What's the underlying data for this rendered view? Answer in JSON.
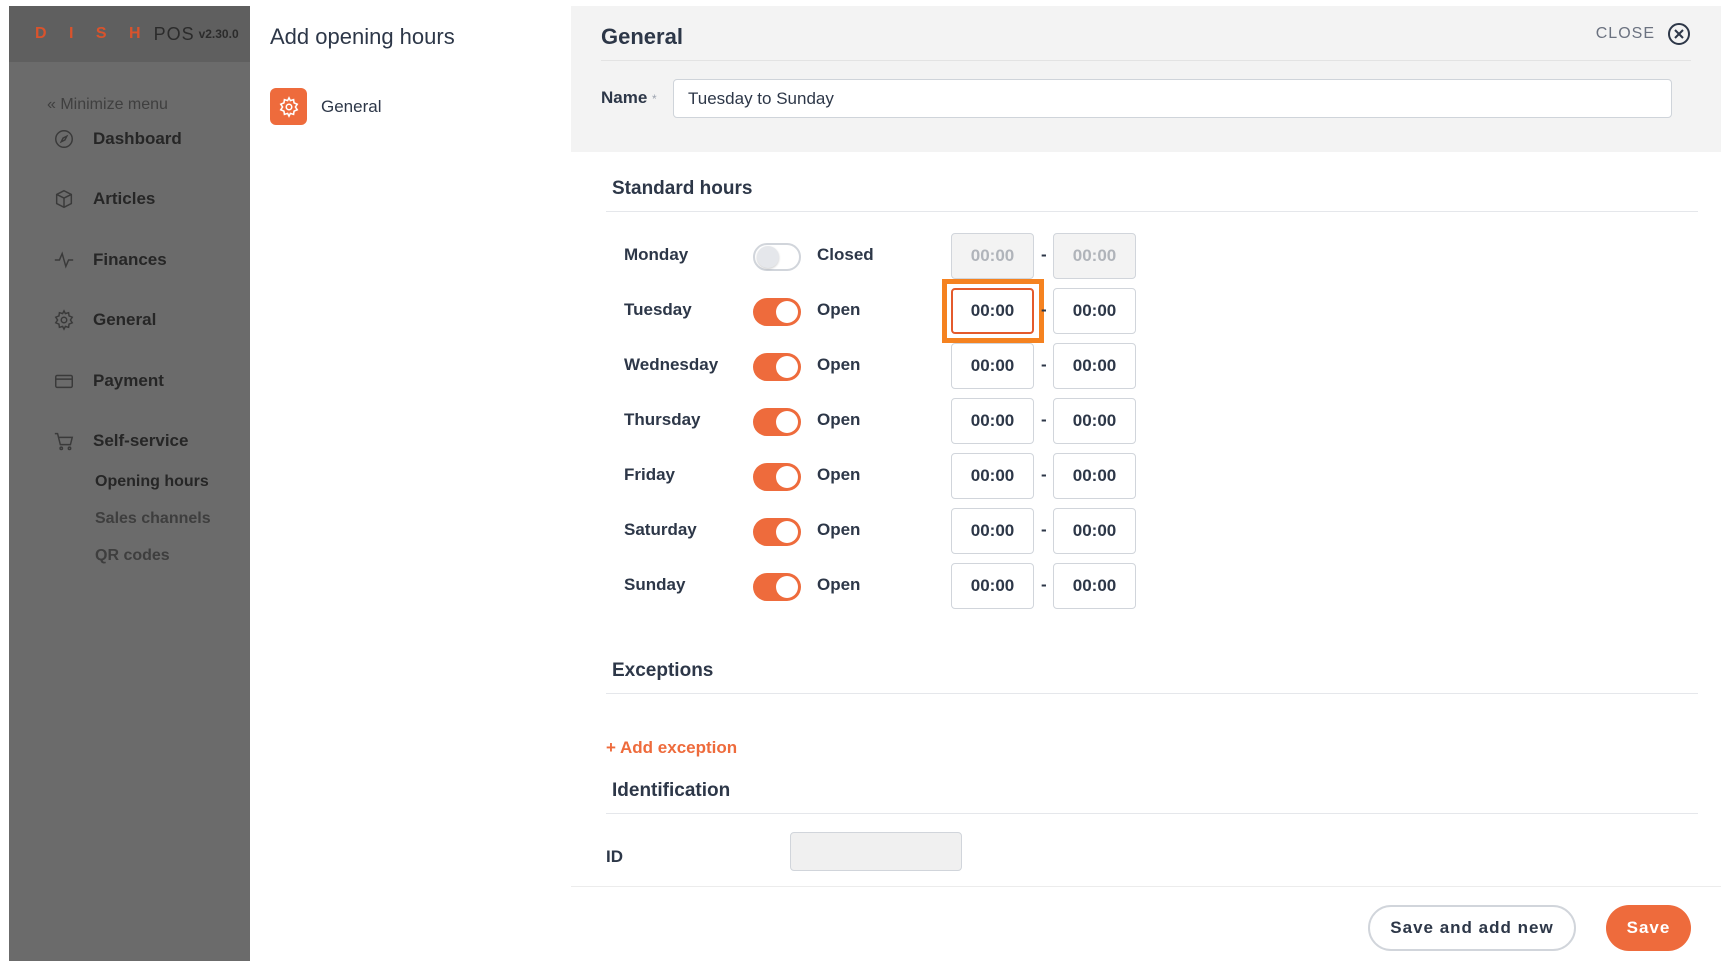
{
  "app": {
    "brand": "D I S H",
    "product": "POS",
    "version": "v2.30.0"
  },
  "sidebar": {
    "minimize_label": "« Minimize menu",
    "items": [
      {
        "label": "Dashboard",
        "icon": "compass-icon"
      },
      {
        "label": "Articles",
        "icon": "box-icon"
      },
      {
        "label": "Finances",
        "icon": "activity-icon"
      },
      {
        "label": "General",
        "icon": "gear-icon"
      },
      {
        "label": "Payment",
        "icon": "card-icon"
      },
      {
        "label": "Self-service",
        "icon": "cart-icon"
      }
    ],
    "sub_items": [
      {
        "label": "Opening hours",
        "active": true
      },
      {
        "label": "Sales channels",
        "active": false
      },
      {
        "label": "QR codes",
        "active": false
      }
    ]
  },
  "steps_panel": {
    "title": "Add opening hours",
    "step_label": "General"
  },
  "form": {
    "header_title": "General",
    "close_label": "CLOSE",
    "name_label": "Name",
    "name_required": "*",
    "name_value": "Tuesday to Sunday",
    "standard_hours_title": "Standard hours",
    "days": [
      {
        "name": "Monday",
        "status": "Closed",
        "open": false,
        "start": "00:00",
        "end": "00:00"
      },
      {
        "name": "Tuesday",
        "status": "Open",
        "open": true,
        "start": "00:00",
        "end": "00:00"
      },
      {
        "name": "Wednesday",
        "status": "Open",
        "open": true,
        "start": "00:00",
        "end": "00:00"
      },
      {
        "name": "Thursday",
        "status": "Open",
        "open": true,
        "start": "00:00",
        "end": "00:00"
      },
      {
        "name": "Friday",
        "status": "Open",
        "open": true,
        "start": "00:00",
        "end": "00:00"
      },
      {
        "name": "Saturday",
        "status": "Open",
        "open": true,
        "start": "00:00",
        "end": "00:00"
      },
      {
        "name": "Sunday",
        "status": "Open",
        "open": true,
        "start": "00:00",
        "end": "00:00"
      }
    ],
    "separator": "-",
    "exceptions_title": "Exceptions",
    "add_exception_label": "+ Add exception",
    "identification_title": "Identification",
    "id_label": "ID",
    "id_value": ""
  },
  "footer": {
    "save_and_add_new_label": "Save and add new",
    "save_label": "Save"
  },
  "colors": {
    "accent": "#ee6b3c",
    "highlight": "#f58220",
    "sidebar_bg": "#6b6b6b"
  }
}
